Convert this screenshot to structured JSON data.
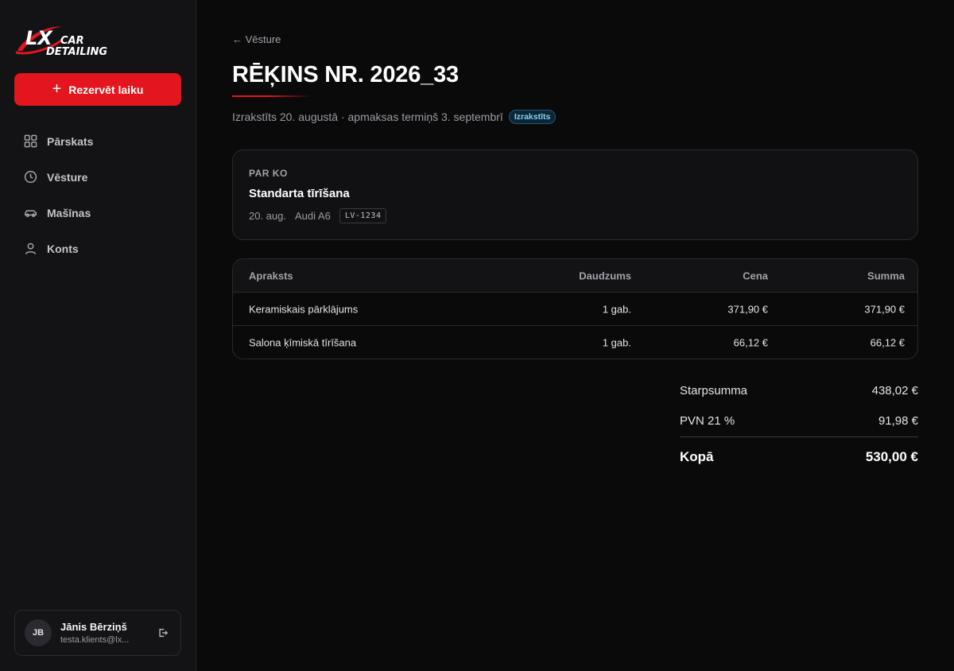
{
  "brand": {
    "logo_line1": "CAR",
    "logo_line2": "DETAILING",
    "logo_mark": "LX",
    "accent": "#e3161f"
  },
  "sidebar": {
    "book_button": "Rezervēt laiku",
    "items": [
      {
        "label": "Pārskats",
        "icon": "grid-icon"
      },
      {
        "label": "Vēsture",
        "icon": "clock-icon"
      },
      {
        "label": "Mašīnas",
        "icon": "car-icon"
      },
      {
        "label": "Konts",
        "icon": "user-icon"
      }
    ],
    "user": {
      "initials": "JB",
      "name": "Jānis Bērziņš",
      "email": "testa.klients@lx..."
    }
  },
  "invoice": {
    "back_link": "← Vēsture",
    "title": "RĒĶINS NR. 2026_33",
    "issued": "Izrakstīts 20. augustā · apmaksas termiņš 3. septembrī",
    "status": "Izrakstīts",
    "for_label": "PAR KO",
    "service": "Standarta tīrīšana",
    "date": "20. aug.",
    "car": "Audi A6",
    "plate": "LV-1234",
    "table": {
      "headers": {
        "desc": "Apraksts",
        "qty": "Daudzums",
        "price": "Cena",
        "sum": "Summa"
      },
      "rows": [
        {
          "desc": "Keramiskais pārklājums",
          "qty": "1 gab.",
          "price": "371,90 €",
          "sum": "371,90 €"
        },
        {
          "desc": "Salona ķīmiskā tīrīšana",
          "qty": "1 gab.",
          "price": "66,12 €",
          "sum": "66,12 €"
        }
      ]
    },
    "totals": {
      "subtotal_label": "Starpsumma",
      "subtotal": "438,02 €",
      "vat_label": "PVN 21 %",
      "vat": "91,98 €",
      "total_label": "Kopā",
      "total": "530,00 €"
    }
  }
}
